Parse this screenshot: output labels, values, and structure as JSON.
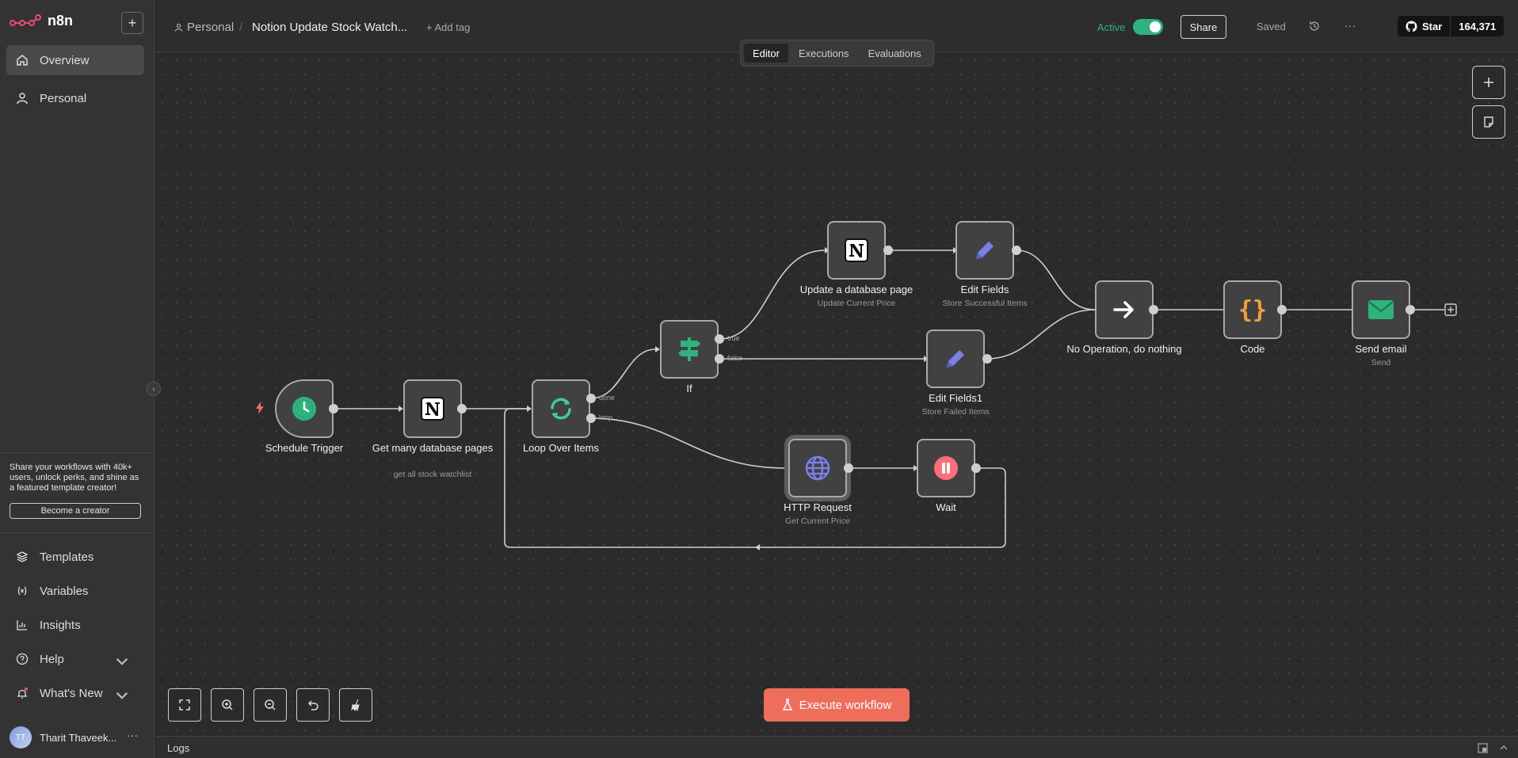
{
  "app": {
    "name": "n8n"
  },
  "sidebar": {
    "new_label": "+",
    "items": [
      {
        "label": "Overview",
        "icon": "home-icon"
      },
      {
        "label": "Personal",
        "icon": "user-icon"
      }
    ],
    "promo": {
      "text": "Share your workflows with 40k+ users, unlock perks, and shine as a featured template creator!",
      "button": "Become a creator"
    },
    "bottom_items": [
      {
        "label": "Templates",
        "icon": "templates-icon"
      },
      {
        "label": "Variables",
        "icon": "variables-icon"
      },
      {
        "label": "Insights",
        "icon": "insights-icon"
      },
      {
        "label": "Help",
        "icon": "help-icon"
      },
      {
        "label": "What's New",
        "icon": "bell-icon"
      }
    ],
    "user": {
      "initials": "TT",
      "name": "Tharit Thaveek..."
    }
  },
  "header": {
    "owner": "Personal",
    "separator": "/",
    "workflow_title": "Notion Update Stock Watch...",
    "add_tag": "+ Add tag",
    "active_label": "Active",
    "active": true,
    "share": "Share",
    "saved": "Saved",
    "github_star": "Star",
    "github_count": "164,371"
  },
  "tabs": [
    "Editor",
    "Executions",
    "Evaluations"
  ],
  "nodes": {
    "schedule": {
      "label": "Schedule Trigger",
      "sub": ""
    },
    "getmany": {
      "label": "Get many database pages",
      "sub": "get all stock watchlist"
    },
    "loop": {
      "label": "Loop Over Items",
      "sub": "",
      "ports": [
        "done",
        "loop"
      ]
    },
    "if": {
      "label": "If",
      "sub": "",
      "ports": [
        "true",
        "false"
      ]
    },
    "update": {
      "label": "Update a database page",
      "sub": "Update Current Price"
    },
    "editfields": {
      "label": "Edit Fields",
      "sub": "Store Successful Items"
    },
    "editfields1": {
      "label": "Edit Fields1",
      "sub": "Store Failed Items"
    },
    "noop": {
      "label": "No Operation, do nothing",
      "sub": ""
    },
    "code": {
      "label": "Code",
      "sub": ""
    },
    "email": {
      "label": "Send email",
      "sub": "Send"
    },
    "http": {
      "label": "HTTP Request",
      "sub": "Get Current Price"
    },
    "wait": {
      "label": "Wait",
      "sub": ""
    }
  },
  "execute_button": "Execute workflow",
  "logs_label": "Logs",
  "colors": {
    "accent": "#ef6d5b",
    "active_green": "#2fb37c",
    "node_bg": "#414142"
  }
}
